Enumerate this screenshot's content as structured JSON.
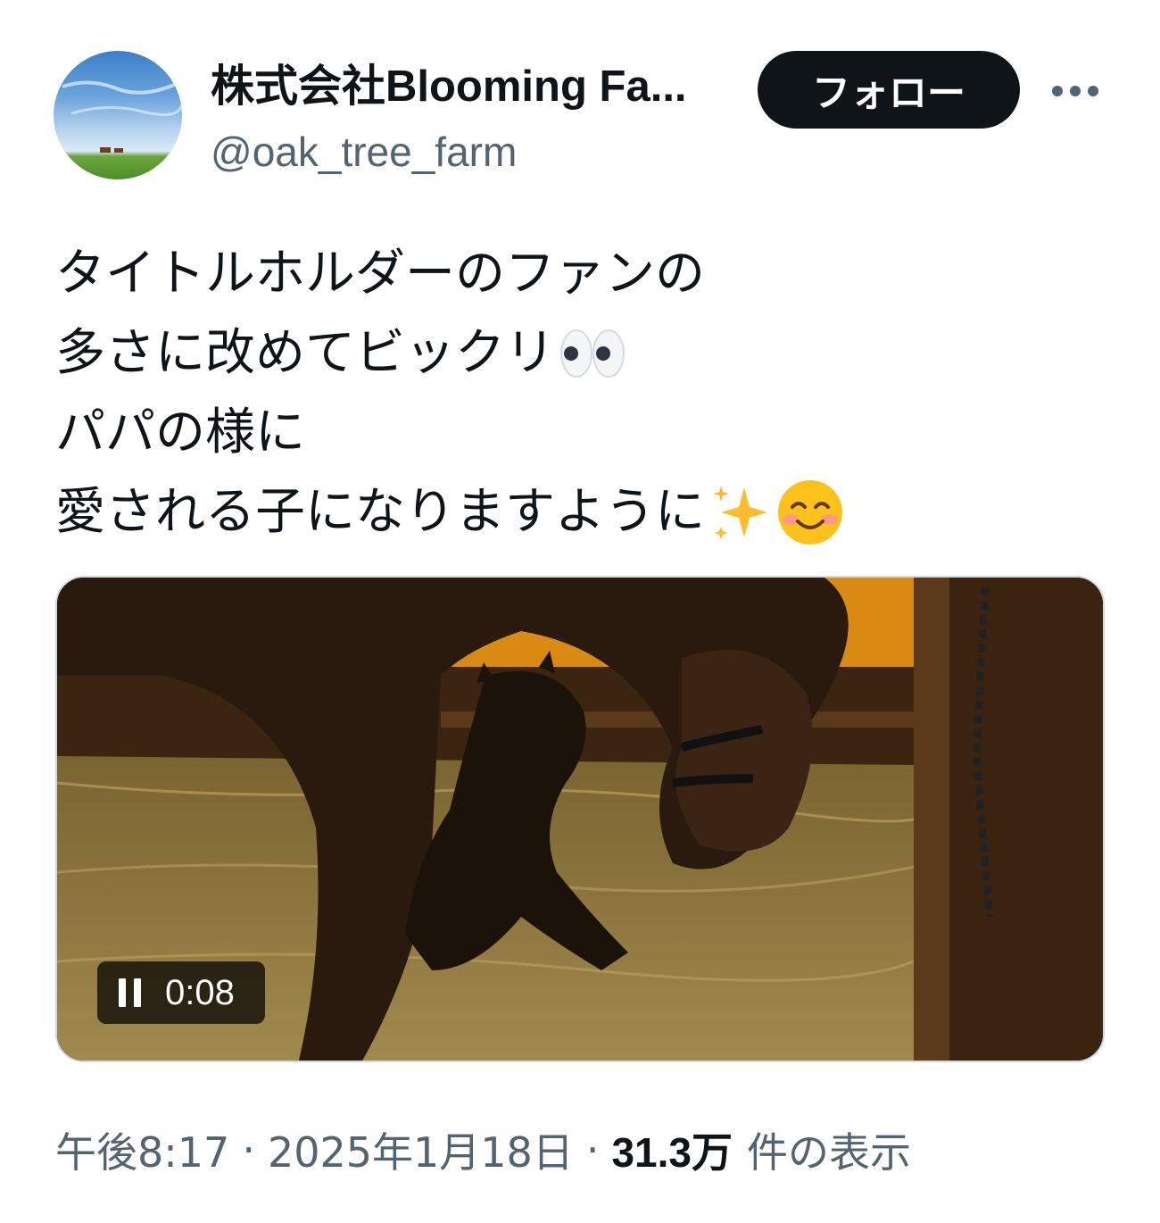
{
  "author": {
    "display_name": "株式会社Blooming Fa...",
    "handle": "@oak_tree_farm",
    "avatar_icon": "farm-landscape-avatar"
  },
  "actions": {
    "follow_label": "フォロー",
    "more_icon": "more-horizontal-icon"
  },
  "tweet": {
    "lines": [
      "タイトルホルダーのファンの",
      "多さに改めてビックリ",
      "パパの様に",
      "愛される子になりますように"
    ],
    "emojis": [
      "eyes-emoji",
      "sparkles-emoji",
      "smiling-face-emoji"
    ]
  },
  "media": {
    "type": "video",
    "state": "playing",
    "elapsed": "0:08",
    "control_icon": "pause-icon"
  },
  "meta": {
    "time": "午後8:17",
    "separator": "·",
    "date": "2025年1月18日",
    "views_count": "31.3万",
    "views_label": "件の表示"
  },
  "colors": {
    "text_primary": "#0f1419",
    "text_secondary": "#536471",
    "follow_bg": "#0f1419",
    "media_border": "#cfd9de"
  }
}
